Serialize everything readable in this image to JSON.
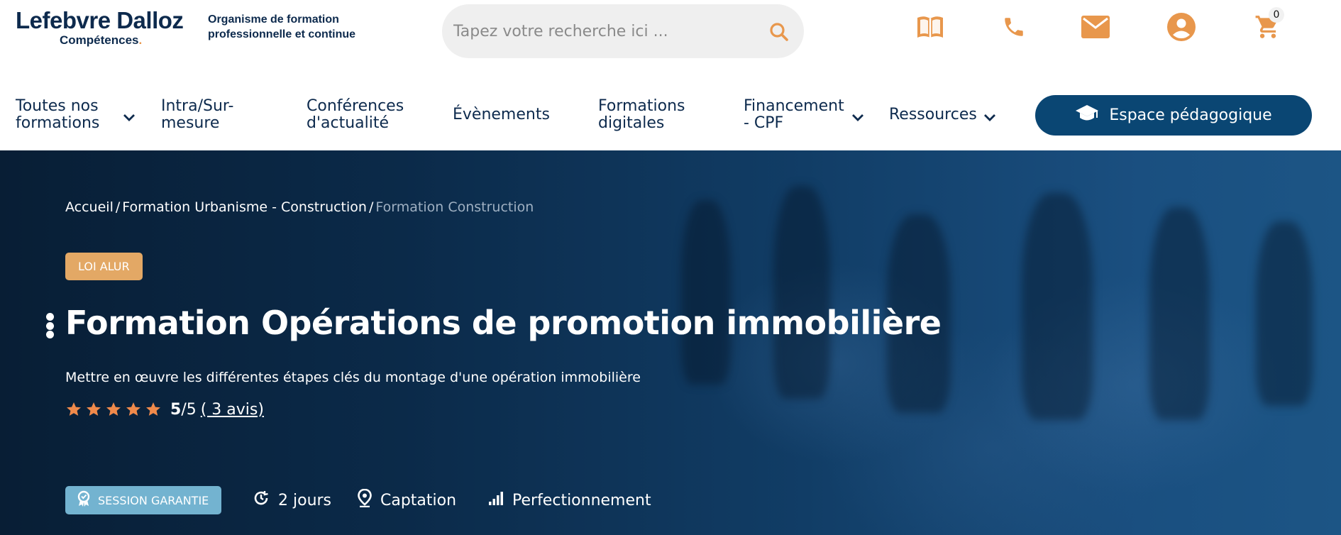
{
  "header": {
    "logo": {
      "brand": "Lefebvre Dalloz",
      "sub": "Compétences",
      "sub_dot": "."
    },
    "tagline": "Organisme de formation professionnelle et continue",
    "search": {
      "placeholder": "Tapez votre recherche ici ..."
    },
    "icons": [
      "book-icon",
      "phone-icon",
      "mail-icon",
      "account-icon",
      "cart-icon"
    ],
    "cart_count": "0",
    "accent_color": "#e8974c"
  },
  "nav": {
    "items": [
      {
        "label": "Toutes nos formations",
        "dropdown": true
      },
      {
        "label": "Intra/Sur-mesure",
        "dropdown": false
      },
      {
        "label": "Conférences d'actualité",
        "dropdown": false
      },
      {
        "label": "Évènements",
        "dropdown": false
      },
      {
        "label": "Formations digitales",
        "dropdown": false
      },
      {
        "label": "Financement - CPF",
        "dropdown": true
      },
      {
        "label": "Ressources",
        "dropdown": true
      }
    ],
    "cta_label": "Espace pédagogique",
    "cta_color": "#0a4673"
  },
  "hero": {
    "breadcrumb": [
      {
        "label": "Accueil",
        "sep": "/"
      },
      {
        "label": "Formation Urbanisme - Construction",
        "sep": "/"
      },
      {
        "label": "Formation Construction"
      }
    ],
    "tag": "LOI ALUR",
    "tag_color": "#e3a865",
    "title": "Formation Opérations de promotion immobilière",
    "subtitle": "Mettre en œuvre les différentes étapes clés du montage d'une opération immobilière",
    "rating": {
      "stars": 5,
      "score": "5",
      "out_of": "/5",
      "reviews": "( 3 avis)",
      "star_color": "#f08a4b"
    },
    "session_badge": "SESSION GARANTIE",
    "session_color": "#73b3d0",
    "meta": [
      {
        "icon": "duration-icon",
        "label": "2 jours"
      },
      {
        "icon": "location-pin-icon",
        "label": "Captation"
      },
      {
        "icon": "level-bars-icon",
        "label": "Perfectionnement"
      }
    ]
  }
}
